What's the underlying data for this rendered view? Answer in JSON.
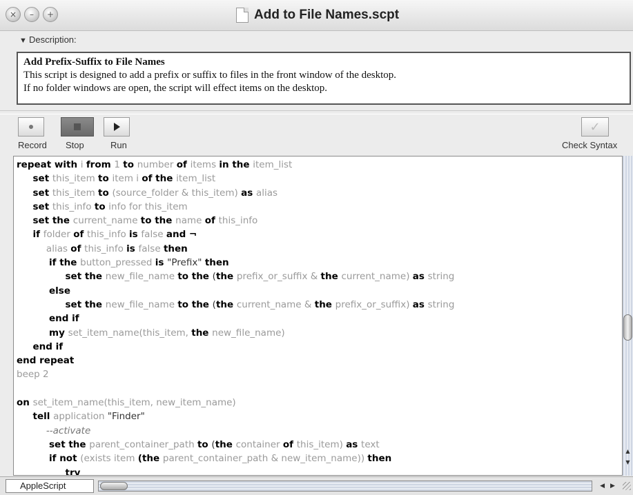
{
  "window": {
    "title": "Add to File Names.scpt",
    "buttons": [
      "close",
      "minimize",
      "zoom"
    ]
  },
  "description": {
    "label": "Description:",
    "heading": "Add Prefix-Suffix to File Names",
    "line1": "This script is designed to add a prefix or suffix to files in the front window of the desktop.",
    "line2": "If no folder windows are open, the script will effect items on the desktop."
  },
  "toolbar": {
    "record_label": "Record",
    "stop_label": "Stop",
    "run_label": "Run",
    "check_syntax_label": "Check Syntax"
  },
  "code_lines": [
    [
      {
        "t": "repeat with ",
        "c": "kw"
      },
      {
        "t": "i ",
        "c": "var"
      },
      {
        "t": "from ",
        "c": "kw"
      },
      {
        "t": "1 ",
        "c": "var"
      },
      {
        "t": "to ",
        "c": "kw"
      },
      {
        "t": "number ",
        "c": "var"
      },
      {
        "t": "of ",
        "c": "kw"
      },
      {
        "t": "items ",
        "c": "var"
      },
      {
        "t": "in the ",
        "c": "kw"
      },
      {
        "t": "item_list",
        "c": "var"
      }
    ],
    [
      {
        "t": "     set ",
        "c": "kw"
      },
      {
        "t": "this_item ",
        "c": "var"
      },
      {
        "t": "to ",
        "c": "kw"
      },
      {
        "t": "item i ",
        "c": "var"
      },
      {
        "t": "of the ",
        "c": "kw"
      },
      {
        "t": "item_list",
        "c": "var"
      }
    ],
    [
      {
        "t": "     set ",
        "c": "kw"
      },
      {
        "t": "this_item ",
        "c": "var"
      },
      {
        "t": "to ",
        "c": "kw"
      },
      {
        "t": "(source_folder & this_item) ",
        "c": "var"
      },
      {
        "t": "as ",
        "c": "kw"
      },
      {
        "t": "alias",
        "c": "var"
      }
    ],
    [
      {
        "t": "     set ",
        "c": "kw"
      },
      {
        "t": "this_info ",
        "c": "var"
      },
      {
        "t": "to ",
        "c": "kw"
      },
      {
        "t": "info for this_item",
        "c": "var"
      }
    ],
    [
      {
        "t": "     set the ",
        "c": "kw"
      },
      {
        "t": "current_name ",
        "c": "var"
      },
      {
        "t": "to the ",
        "c": "kw"
      },
      {
        "t": "name ",
        "c": "var"
      },
      {
        "t": "of ",
        "c": "kw"
      },
      {
        "t": "this_info",
        "c": "var"
      }
    ],
    [
      {
        "t": "     if ",
        "c": "kw"
      },
      {
        "t": "folder ",
        "c": "var"
      },
      {
        "t": "of ",
        "c": "kw"
      },
      {
        "t": "this_info ",
        "c": "var"
      },
      {
        "t": "is ",
        "c": "kw"
      },
      {
        "t": "false ",
        "c": "var"
      },
      {
        "t": "and ¬",
        "c": "kw"
      }
    ],
    [
      {
        "t": "          ",
        "c": "op"
      },
      {
        "t": "alias ",
        "c": "var"
      },
      {
        "t": "of ",
        "c": "kw"
      },
      {
        "t": "this_info ",
        "c": "var"
      },
      {
        "t": "is ",
        "c": "kw"
      },
      {
        "t": "false ",
        "c": "var"
      },
      {
        "t": "then",
        "c": "kw"
      }
    ],
    [
      {
        "t": "          if the ",
        "c": "kw"
      },
      {
        "t": "button_pressed ",
        "c": "var"
      },
      {
        "t": "is ",
        "c": "kw"
      },
      {
        "t": "\"Prefix\" ",
        "c": "op"
      },
      {
        "t": "then",
        "c": "kw"
      }
    ],
    [
      {
        "t": "               set the ",
        "c": "kw"
      },
      {
        "t": "new_file_name ",
        "c": "var"
      },
      {
        "t": "to the ",
        "c": "kw"
      },
      {
        "t": "(",
        "c": "op"
      },
      {
        "t": "the ",
        "c": "kw"
      },
      {
        "t": "prefix_or_suffix & ",
        "c": "var"
      },
      {
        "t": "the ",
        "c": "kw"
      },
      {
        "t": "current_name) ",
        "c": "var"
      },
      {
        "t": "as ",
        "c": "kw"
      },
      {
        "t": "string",
        "c": "var"
      }
    ],
    [
      {
        "t": "          else",
        "c": "kw"
      }
    ],
    [
      {
        "t": "               set the ",
        "c": "kw"
      },
      {
        "t": "new_file_name ",
        "c": "var"
      },
      {
        "t": "to the ",
        "c": "kw"
      },
      {
        "t": "(",
        "c": "op"
      },
      {
        "t": "the ",
        "c": "kw"
      },
      {
        "t": "current_name & ",
        "c": "var"
      },
      {
        "t": "the ",
        "c": "kw"
      },
      {
        "t": "prefix_or_suffix) ",
        "c": "var"
      },
      {
        "t": "as ",
        "c": "kw"
      },
      {
        "t": "string",
        "c": "var"
      }
    ],
    [
      {
        "t": "          end if",
        "c": "kw"
      }
    ],
    [
      {
        "t": "          my ",
        "c": "kw"
      },
      {
        "t": "set_item_name(this_item, ",
        "c": "var"
      },
      {
        "t": "the ",
        "c": "kw"
      },
      {
        "t": "new_file_name)",
        "c": "var"
      }
    ],
    [
      {
        "t": "     end if",
        "c": "kw"
      }
    ],
    [
      {
        "t": "end repeat",
        "c": "kw"
      }
    ],
    [
      {
        "t": "beep 2",
        "c": "var"
      }
    ],
    [
      {
        "t": "",
        "c": "op"
      }
    ],
    [
      {
        "t": "on ",
        "c": "kw"
      },
      {
        "t": "set_item_name(this_item, new_item_name)",
        "c": "var"
      }
    ],
    [
      {
        "t": "     tell ",
        "c": "kw"
      },
      {
        "t": "application ",
        "c": "var"
      },
      {
        "t": "\"Finder\"",
        "c": "op"
      }
    ],
    [
      {
        "t": "          --activate",
        "c": "ital"
      }
    ],
    [
      {
        "t": "          set the ",
        "c": "kw"
      },
      {
        "t": "parent_container_path ",
        "c": "var"
      },
      {
        "t": "to ",
        "c": "kw"
      },
      {
        "t": "(",
        "c": "op"
      },
      {
        "t": "the ",
        "c": "kw"
      },
      {
        "t": "container ",
        "c": "var"
      },
      {
        "t": "of ",
        "c": "kw"
      },
      {
        "t": "this_item) ",
        "c": "var"
      },
      {
        "t": "as ",
        "c": "kw"
      },
      {
        "t": "text",
        "c": "var"
      }
    ],
    [
      {
        "t": "          if not ",
        "c": "kw"
      },
      {
        "t": "(exists item ",
        "c": "var"
      },
      {
        "t": "(the ",
        "c": "kw"
      },
      {
        "t": "parent_container_path & new_item_name)) ",
        "c": "var"
      },
      {
        "t": "then",
        "c": "kw"
      }
    ],
    [
      {
        "t": "               try",
        "c": "kw"
      }
    ]
  ],
  "footer": {
    "language": "AppleScript"
  }
}
